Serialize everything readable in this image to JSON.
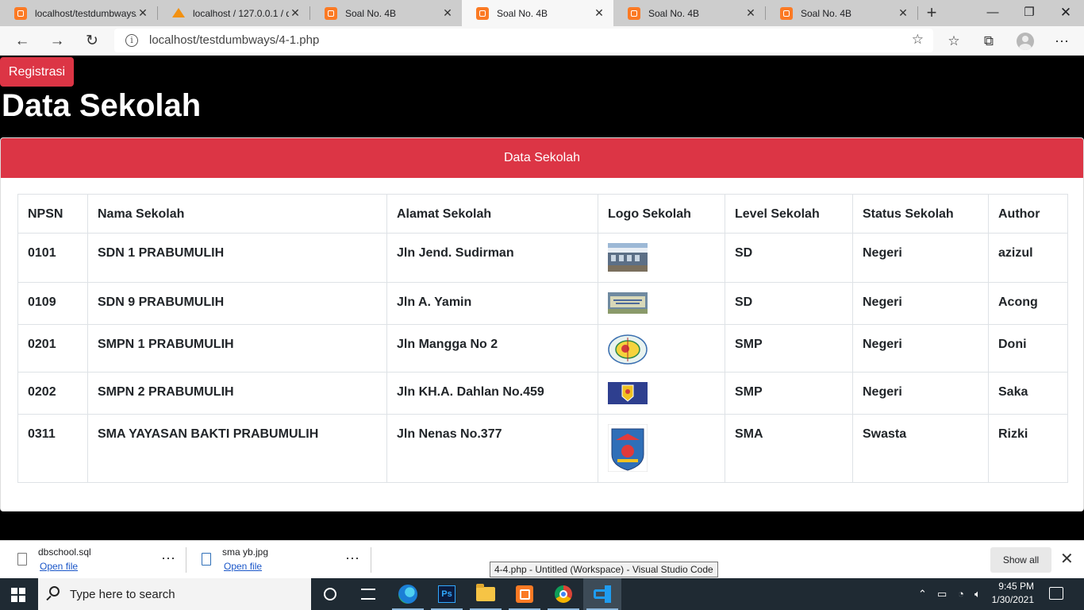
{
  "browser": {
    "tabs": [
      {
        "title": "localhost/testdumbways/",
        "active": false,
        "icon": "xampp-icon"
      },
      {
        "title": "localhost / 127.0.0.1 / d",
        "active": false,
        "icon": "phpmyadmin-icon"
      },
      {
        "title": "Soal No. 4B",
        "active": false,
        "icon": "xampp-icon"
      },
      {
        "title": "Soal No. 4B",
        "active": true,
        "icon": "xampp-icon"
      },
      {
        "title": "Soal No. 4B",
        "active": false,
        "icon": "xampp-icon"
      },
      {
        "title": "Soal No. 4B",
        "active": false,
        "icon": "xampp-icon"
      }
    ],
    "url": "localhost/testdumbways/4-1.php"
  },
  "page": {
    "register_button": "Registrasi",
    "title": "Data Sekolah",
    "card_title": "Data Sekolah",
    "colors": {
      "accent": "#dc3545",
      "background": "#000000"
    },
    "table": {
      "headers": [
        "NPSN",
        "Nama Sekolah",
        "Alamat Sekolah",
        "Logo Sekolah",
        "Level Sekolah",
        "Status Sekolah",
        "Author"
      ],
      "rows": [
        {
          "npsn": "0101",
          "nama": "SDN 1 PRABUMULIH",
          "alamat": "Jln Jend. Sudirman",
          "logo": "school-building-photo",
          "level": "SD",
          "status": "Negeri",
          "author": "azizul"
        },
        {
          "npsn": "0109",
          "nama": "SDN 9 PRABUMULIH",
          "alamat": "Jln A. Yamin",
          "logo": "school-sign-photo",
          "level": "SD",
          "status": "Negeri",
          "author": "Acong"
        },
        {
          "npsn": "0201",
          "nama": "SMPN 1 PRABUMULIH",
          "alamat": "Jln Mangga No 2",
          "logo": "school-round-emblem",
          "level": "SMP",
          "status": "Negeri",
          "author": "Doni"
        },
        {
          "npsn": "0202",
          "nama": "SMPN 2 PRABUMULIH",
          "alamat": "Jln KH.A. Dahlan No.459",
          "logo": "school-blue-emblem",
          "level": "SMP",
          "status": "Negeri",
          "author": "Saka"
        },
        {
          "npsn": "0311",
          "nama": "SMA YAYASAN BAKTI PRABUMULIH",
          "alamat": "Jln Nenas No.377",
          "logo": "school-shield-emblem",
          "level": "SMA",
          "status": "Swasta",
          "author": "Rizki"
        }
      ]
    }
  },
  "downloads": {
    "items": [
      {
        "name": "dbschool.sql",
        "action": "Open file"
      },
      {
        "name": "sma yb.jpg",
        "action": "Open file"
      }
    ],
    "show_all": "Show all",
    "tooltip": "4-4.php - Untitled (Workspace) - Visual Studio Code"
  },
  "taskbar": {
    "search_placeholder": "Type here to search",
    "time": "9:45 PM",
    "date": "1/30/2021"
  }
}
